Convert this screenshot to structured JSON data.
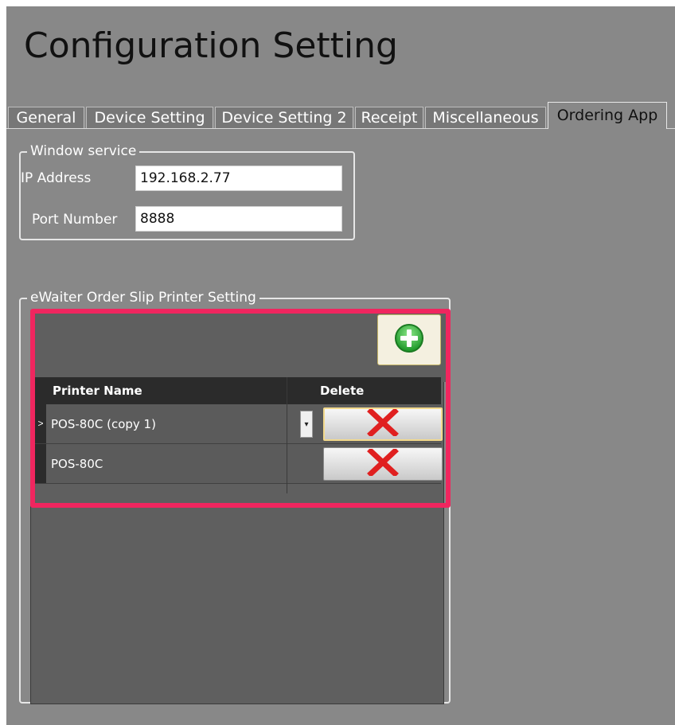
{
  "window": {
    "title": "Configuration Setting"
  },
  "tabs": [
    {
      "label": "General",
      "active": false
    },
    {
      "label": "Device Setting",
      "active": false
    },
    {
      "label": "Device Setting 2",
      "active": false
    },
    {
      "label": "Receipt",
      "active": false
    },
    {
      "label": "Miscellaneous",
      "active": false
    },
    {
      "label": "Ordering App",
      "active": true
    }
  ],
  "window_service": {
    "legend": "Window service",
    "ip_label": "IP Address",
    "ip_value": "192.168.2.77",
    "port_label": "Port Number",
    "port_value": "8888"
  },
  "printer_setting": {
    "legend": "eWaiter Order Slip Printer Setting",
    "add_icon": "plus-circle-icon",
    "columns": {
      "printer_name": "Printer Name",
      "delete": "Delete"
    },
    "rows": [
      {
        "name": "POS-80C (copy 1)",
        "selected": true,
        "indicator": ">"
      },
      {
        "name": "POS-80C",
        "selected": false,
        "indicator": ""
      }
    ],
    "delete_icon": "red-x-icon"
  },
  "colors": {
    "highlight": "#f0265f",
    "add_green": "#2db83d",
    "delete_red": "#e02020",
    "background": "#888888"
  }
}
